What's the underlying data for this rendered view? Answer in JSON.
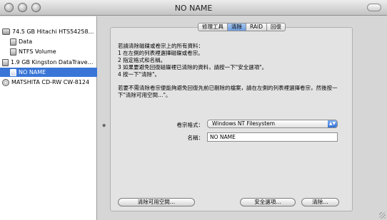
{
  "window": {
    "title": "NO NAME"
  },
  "sidebar": {
    "items": [
      {
        "label": "74.5 GB Hitachi HTS54258…",
        "icon": "hard-disk-icon"
      },
      {
        "label": "Data",
        "icon": "volume-icon"
      },
      {
        "label": "NTFS Volume",
        "icon": "volume-icon"
      },
      {
        "label": "1.9 GB Kingston DataTrave…",
        "icon": "usb-drive-icon"
      },
      {
        "label": "NO NAME",
        "icon": "volume-icon",
        "selected": true
      },
      {
        "label": "MATSHITA CD-RW CW-8124",
        "icon": "optical-drive-icon"
      }
    ]
  },
  "tabs": [
    {
      "label": "修理工具"
    },
    {
      "label": "清除",
      "active": true
    },
    {
      "label": "RAID"
    },
    {
      "label": "回復"
    }
  ],
  "erase": {
    "instructions": "若請清除磁碟或卷宗上的所有資料：\n1 在左側的列表裡選擇磁碟或卷宗。\n2 指定格式和名稱。\n3 如果要避免回復磁碟裡已清除的資料，請按一下\"安全選項\"。\n4 按一下\"清除\"。",
    "note": "若要不需清除卷宗便能夠避免回復先前已刪除的檔案，請在左側的列表裡選擇卷宗，然後按一下\"清除可用空間…\"。",
    "format_label": "卷宗格式：",
    "format_value": "Windows NT Filesystem",
    "name_label": "名稱：",
    "name_value": "NO NAME",
    "buttons": {
      "erase_free_space": "清除可用空間…",
      "security_options": "安全選項…",
      "erase": "清除…"
    }
  },
  "colors": {
    "selection": "#3875d7",
    "active_tab": "#6d9ee0"
  }
}
